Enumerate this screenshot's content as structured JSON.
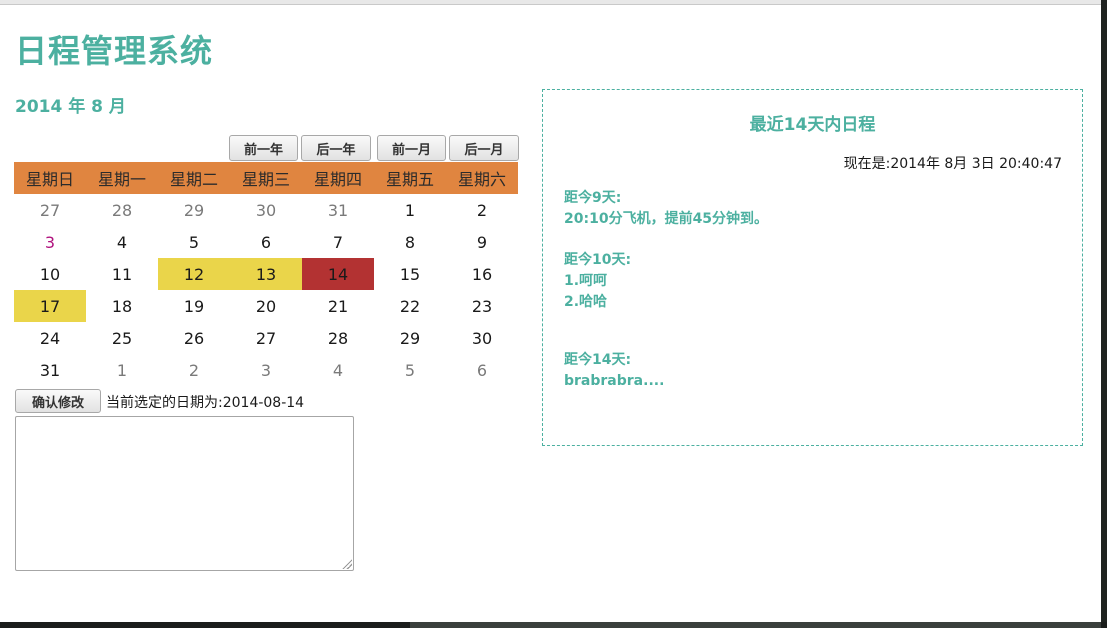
{
  "app": {
    "title": "日程管理系统"
  },
  "calendar": {
    "month_title": "2014 年 8 月",
    "nav": {
      "prev_year": "前一年",
      "next_year": "后一年",
      "prev_month": "前一月",
      "next_month": "后一月"
    },
    "weekdays": [
      "星期日",
      "星期一",
      "星期二",
      "星期三",
      "星期四",
      "星期五",
      "星期六"
    ],
    "weeks": [
      [
        {
          "d": "27",
          "s": "other"
        },
        {
          "d": "28",
          "s": "other"
        },
        {
          "d": "29",
          "s": "other"
        },
        {
          "d": "30",
          "s": "other"
        },
        {
          "d": "31",
          "s": "other"
        },
        {
          "d": "1",
          "s": ""
        },
        {
          "d": "2",
          "s": ""
        }
      ],
      [
        {
          "d": "3",
          "s": "today"
        },
        {
          "d": "4",
          "s": ""
        },
        {
          "d": "5",
          "s": ""
        },
        {
          "d": "6",
          "s": ""
        },
        {
          "d": "7",
          "s": ""
        },
        {
          "d": "8",
          "s": ""
        },
        {
          "d": "9",
          "s": ""
        }
      ],
      [
        {
          "d": "10",
          "s": ""
        },
        {
          "d": "11",
          "s": ""
        },
        {
          "d": "12",
          "s": "event"
        },
        {
          "d": "13",
          "s": "event"
        },
        {
          "d": "14",
          "s": "selected"
        },
        {
          "d": "15",
          "s": ""
        },
        {
          "d": "16",
          "s": ""
        }
      ],
      [
        {
          "d": "17",
          "s": "event"
        },
        {
          "d": "18",
          "s": ""
        },
        {
          "d": "19",
          "s": ""
        },
        {
          "d": "20",
          "s": ""
        },
        {
          "d": "21",
          "s": ""
        },
        {
          "d": "22",
          "s": ""
        },
        {
          "d": "23",
          "s": ""
        }
      ],
      [
        {
          "d": "24",
          "s": ""
        },
        {
          "d": "25",
          "s": ""
        },
        {
          "d": "26",
          "s": ""
        },
        {
          "d": "27",
          "s": ""
        },
        {
          "d": "28",
          "s": ""
        },
        {
          "d": "29",
          "s": ""
        },
        {
          "d": "30",
          "s": ""
        }
      ],
      [
        {
          "d": "31",
          "s": ""
        },
        {
          "d": "1",
          "s": "other"
        },
        {
          "d": "2",
          "s": "other"
        },
        {
          "d": "3",
          "s": "other"
        },
        {
          "d": "4",
          "s": "other"
        },
        {
          "d": "5",
          "s": "other"
        },
        {
          "d": "6",
          "s": "other"
        }
      ]
    ]
  },
  "editor": {
    "confirm_label": "确认修改",
    "selected_date_text": "当前选定的日期为:2014-08-14",
    "note_value": ""
  },
  "schedule": {
    "title": "最近14天内日程",
    "now_text": "现在是:2014年 8月 3日 20:40:47",
    "entries": [
      {
        "heading": "距今9天:",
        "lines": [
          "20:10分飞机，提前45分钟到。"
        ]
      },
      {
        "heading": "距今10天:",
        "lines": [
          "1.呵呵",
          "2.哈哈"
        ]
      },
      {
        "heading": "距今14天:",
        "lines": [
          "brabrabra...."
        ]
      }
    ]
  },
  "colors": {
    "accent": "#4cb0a0",
    "weekday_header": "#e08540",
    "event_day": "#ead54a",
    "selected_day": "#b33232",
    "today_text": "#b0127e"
  }
}
